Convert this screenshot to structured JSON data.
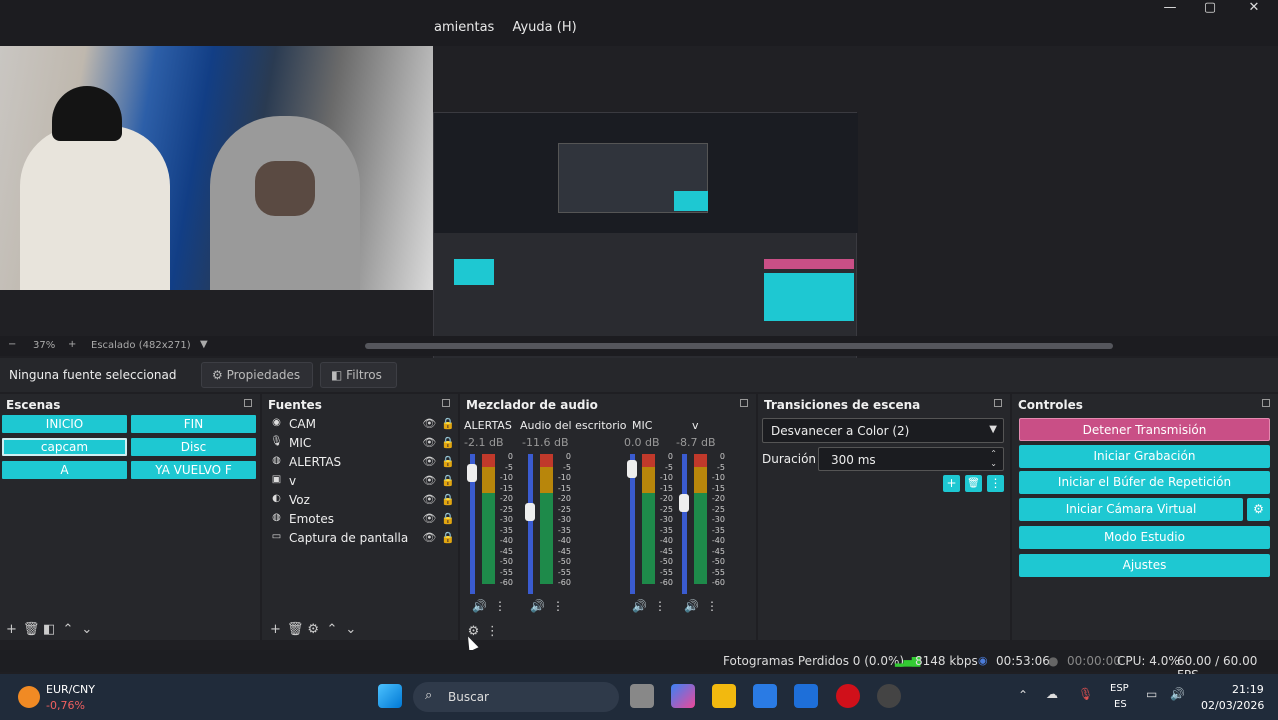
{
  "menu": {
    "items": [
      "amientas",
      "Ayuda (H)"
    ]
  },
  "zoom": {
    "level": "37%",
    "scale": "Escalado (482x271)"
  },
  "source_bar": {
    "no_source": "Ninguna fuente seleccionad",
    "properties": "Propiedades",
    "filters": "Filtros"
  },
  "scenes": {
    "title": "Escenas",
    "items": [
      "INICIO",
      "FIN",
      "capcam",
      "Disc",
      "A",
      "YA VUELVO F"
    ]
  },
  "sources": {
    "title": "Fuentes",
    "items": [
      "CAM",
      "MIC",
      "ALERTAS",
      "v",
      "Voz",
      "Emotes",
      "Captura de pantalla"
    ]
  },
  "mixer": {
    "title": "Mezclador de audio",
    "channels": [
      {
        "name": "ALERTAS",
        "db": "-2.1 dB",
        "level": 0.92
      },
      {
        "name": "Audio del escritorio",
        "db": "-11.6 dB",
        "level": 0.6
      },
      {
        "name": "MIC",
        "db": "0.0 dB",
        "level": 0.95
      },
      {
        "name": "v",
        "db": "-8.7 dB",
        "level": 0.67
      }
    ],
    "scale": [
      "0",
      "-5",
      "-10",
      "-15",
      "-20",
      "-25",
      "-30",
      "-35",
      "-40",
      "-45",
      "-50",
      "-55",
      "-60"
    ]
  },
  "transitions": {
    "title": "Transiciones de escena",
    "selected": "Desvanecer a Color (2)",
    "duration_label": "Duración",
    "duration_value": "300 ms"
  },
  "controls": {
    "title": "Controles",
    "stop_stream": "Detener Transmisión",
    "start_recording": "Iniciar Grabación",
    "replay_buffer": "Iniciar el Búfer de Repetición",
    "virtual_cam": "Iniciar Cámara Virtual",
    "studio_mode": "Modo Estudio",
    "settings": "Ajustes"
  },
  "status": {
    "dropped": "Fotogramas Perdidos 0 (0.0%)",
    "bitrate": "8148 kbps",
    "stream_time": "00:53:06",
    "rec_time": "00:00:00",
    "cpu": "CPU: 4.0%",
    "fps": "60.00 / 60.00 FPS"
  },
  "taskbar": {
    "ticker": "EUR/CNY",
    "ticker_change": "-0,76%",
    "search": "Buscar",
    "lang": "ESP",
    "lang2": "ES",
    "time": "21:19",
    "date": "02/03/2026"
  },
  "colors": {
    "accent": "#1ec8d2",
    "stop": "#c94f86"
  }
}
